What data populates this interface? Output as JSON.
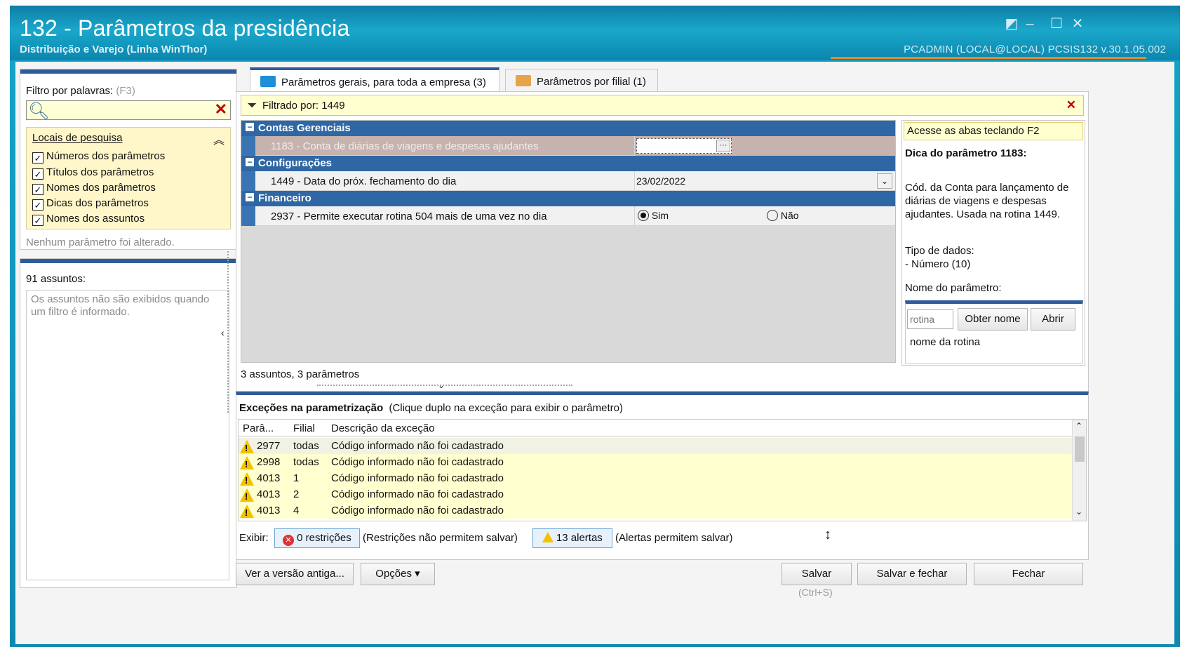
{
  "window": {
    "title": "132 - Parâmetros da presidência",
    "subtitle": "Distribuição e Varejo (Linha WinThor)",
    "user_info": "PCADMIN (LOCAL@LOCAL)   PCSIS132  v.30.1.05.002"
  },
  "left": {
    "filter_label": "Filtro por palavras:",
    "filter_hint": "(F3)",
    "search_value": "",
    "locais_title": "Locais de pesquisa",
    "checkboxes": [
      {
        "label": "Números dos parâmetros",
        "checked": true
      },
      {
        "label": "Títulos dos parâmetros",
        "checked": true
      },
      {
        "label": "Nomes dos parâmetros",
        "checked": true
      },
      {
        "label": "Dicas dos parâmetros",
        "checked": true
      },
      {
        "label": "Nomes dos assuntos",
        "checked": true
      }
    ],
    "status": "Nenhum parâmetro foi alterado.",
    "assuntos_label": "91 assuntos:",
    "assuntos_msg": "Os assuntos não são exibidos quando um filtro é informado."
  },
  "tabs": [
    {
      "label": "Parâmetros gerais, para toda a empresa",
      "count": "(3)",
      "active": true
    },
    {
      "label": "Parâmetros por filial",
      "count": "(1)",
      "active": false
    }
  ],
  "filter_bar": {
    "text": "Filtrado por: 1449"
  },
  "groups": [
    {
      "title": "Contas Gerenciais",
      "rows": [
        {
          "text": "1183 - Conta de diárias de viagens e despesas ajudantes",
          "value": "",
          "selected": true
        }
      ]
    },
    {
      "title": "Configurações",
      "rows": [
        {
          "text": "1449 - Data do próx. fechamento do dia",
          "value": "23/02/2022"
        }
      ]
    },
    {
      "title": "Financeiro",
      "rows": [
        {
          "text": "2937 - Permite executar rotina 504 mais de uma vez no dia",
          "opt_sim": "Sim",
          "opt_nao": "Não"
        }
      ]
    }
  ],
  "grid_footer": "3 assuntos, 3 parâmetros",
  "tip": {
    "header": "Acesse as abas teclando F2",
    "title": "Dica do parâmetro 1183:",
    "description": "Cód. da Conta para lançamento de diárias de viagens e despesas ajudantes. Usada na rotina 1449.",
    "type_label": "Tipo de dados:",
    "type_value": " - Número (10)",
    "name_label": "Nome do parâmetro:",
    "rotina_placeholder": "rotina",
    "btn_obter": "Obter nome",
    "btn_abrir": "Abrir",
    "rotina_name": "nome da rotina"
  },
  "exceptions": {
    "title": "Exceções na parametrização",
    "hint": "(Clique duplo na exceção para exibir o parâmetro)",
    "headers": [
      "Parâ...",
      "Filial",
      "Descrição da exceção"
    ],
    "rows": [
      {
        "param": "2977",
        "filial": "todas",
        "desc": "Código informado não foi cadastrado"
      },
      {
        "param": "2998",
        "filial": "todas",
        "desc": "Código informado não foi cadastrado"
      },
      {
        "param": "4013",
        "filial": "1",
        "desc": "Código informado não foi cadastrado"
      },
      {
        "param": "4013",
        "filial": "2",
        "desc": "Código informado não foi cadastrado"
      },
      {
        "param": "4013",
        "filial": "4",
        "desc": "Código informado não foi cadastrado"
      }
    ],
    "exibir": "Exibir:",
    "restricoes_btn": "0 restrições",
    "restricoes_note": "(Restrições não permitem salvar)",
    "alertas_btn": "13 alertas",
    "alertas_note": "(Alertas permitem salvar)"
  },
  "footer": {
    "ver_versao": "Ver a versão antiga...",
    "opcoes": "Opções",
    "salvar": "Salvar",
    "salvar_hint": "(Ctrl+S)",
    "salvar_fechar": "Salvar e fechar",
    "fechar": "Fechar"
  },
  "colors": {
    "accent": "#2e5c9b",
    "group": "#2f67a5",
    "warn": "#f2c200",
    "titlebar": "#13a3c6"
  }
}
